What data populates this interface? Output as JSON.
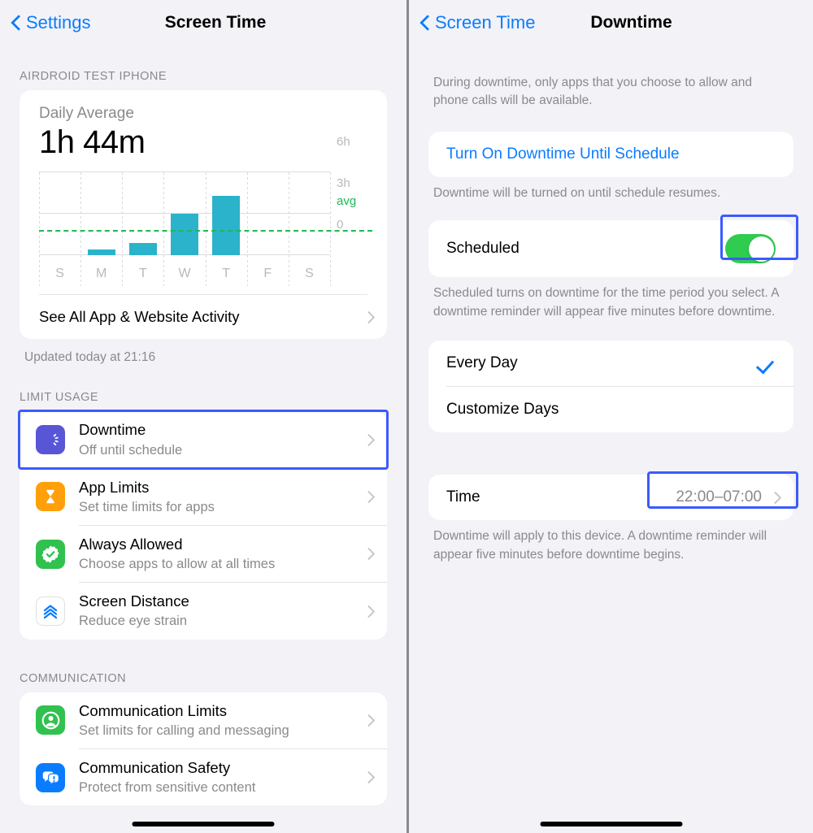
{
  "left": {
    "nav": {
      "back_label": "Settings",
      "title": "Screen Time",
      "back_icon": "chevron-left-icon"
    },
    "device_section_label": "AIRDROID TEST IPHONE",
    "summary": {
      "label": "Daily Average",
      "value": "1h 44m"
    },
    "see_all_label": "See All App & Website Activity",
    "updated_text": "Updated today at 21:16",
    "limit_usage_label": "LIMIT USAGE",
    "limit_items": [
      {
        "title": "Downtime",
        "subtitle": "Off until schedule",
        "icon": "downtime-clock-icon",
        "color": "#5856d6",
        "highlighted": true
      },
      {
        "title": "App Limits",
        "subtitle": "Set time limits for apps",
        "icon": "hourglass-icon",
        "color": "#ff9f0a",
        "highlighted": false
      },
      {
        "title": "Always Allowed",
        "subtitle": "Choose apps to allow at all times",
        "icon": "check-badge-icon",
        "color": "#30c14e",
        "highlighted": false
      },
      {
        "title": "Screen Distance",
        "subtitle": "Reduce eye strain",
        "icon": "chevrons-up-icon",
        "color": "#ffffff",
        "highlighted": false
      }
    ],
    "communication_label": "COMMUNICATION",
    "communication_items": [
      {
        "title": "Communication Limits",
        "subtitle": "Set limits for calling and messaging",
        "icon": "person-circle-icon",
        "color": "#30c14e"
      },
      {
        "title": "Communication Safety",
        "subtitle": "Protect from sensitive content",
        "icon": "chat-alert-icon",
        "color": "#0a7cff"
      }
    ]
  },
  "right": {
    "nav": {
      "back_label": "Screen Time",
      "title": "Downtime",
      "back_icon": "chevron-left-icon"
    },
    "intro_text": "During downtime, only apps that you choose to allow and phone calls will be available.",
    "turn_on_label": "Turn On Downtime Until Schedule",
    "turn_on_footnote": "Downtime will be turned on until schedule resumes.",
    "scheduled_label": "Scheduled",
    "scheduled_on": true,
    "scheduled_footnote": "Scheduled turns on downtime for the time period you select. A downtime reminder will appear five minutes before downtime.",
    "every_day_label": "Every Day",
    "every_day_selected": true,
    "customize_days_label": "Customize Days",
    "time_label": "Time",
    "time_value": "22:00–07:00",
    "time_footnote": "Downtime will apply to this device. A downtime reminder will appear five minutes before downtime begins."
  },
  "colors": {
    "accent_blue": "#0a7cff",
    "bar_teal": "#2bb3cb",
    "avg_green": "#1db954",
    "toggle_green": "#2fcc50",
    "highlight_blue": "#3b5bfd"
  },
  "chart_data": {
    "type": "bar",
    "title": "Daily Average",
    "categories": [
      "S",
      "M",
      "T",
      "W",
      "T",
      "F",
      "S"
    ],
    "values": [
      0,
      0.4,
      0.9,
      3.0,
      4.3,
      0,
      0
    ],
    "ylabel": "",
    "xlabel": "",
    "ylim": [
      0,
      6
    ],
    "ytick_labels": [
      "0",
      "3h",
      "6h"
    ],
    "ytick_values": [
      0,
      3,
      6
    ],
    "average_line": {
      "label": "avg",
      "value": 1.733,
      "color": "#1db954",
      "style": "dashed"
    },
    "grid": true,
    "legend": "none",
    "units": "hours"
  }
}
